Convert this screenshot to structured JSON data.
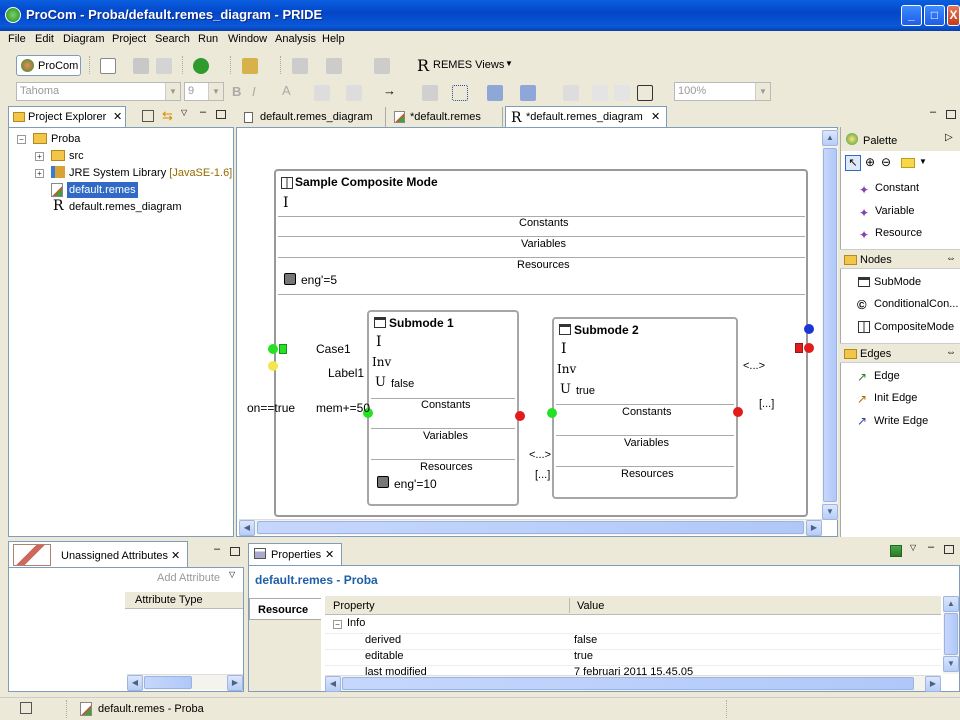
{
  "window": {
    "title": "ProCom - Proba/default.remes_diagram - PRIDE",
    "min": "_",
    "max": "□",
    "close": "X"
  },
  "menu": [
    "File",
    "Edit",
    "Diagram",
    "Project",
    "Search",
    "Run",
    "Window",
    "Analysis",
    "Help"
  ],
  "toolbar": {
    "procom_label": "ProCom",
    "remes_views_label": "REMES Views",
    "font_combo": "Tahoma",
    "size_combo": "9",
    "zoom_combo": "100%"
  },
  "project_explorer": {
    "tab_label": "Project Explorer",
    "tree": [
      {
        "label": "Proba"
      },
      {
        "label": "src"
      },
      {
        "label": "JRE System Library",
        "suffix": "[JavaSE-1.6]"
      },
      {
        "label": "default.remes"
      },
      {
        "label": "default.remes_diagram"
      }
    ]
  },
  "editor_tabs": [
    {
      "label": "default.remes_diagram"
    },
    {
      "label": "*default.remes"
    },
    {
      "label": "*default.remes_diagram"
    }
  ],
  "diagram": {
    "composite": {
      "title": "Sample Composite Mode",
      "invariant": "I",
      "constants": "Constants",
      "variables": "Variables",
      "resources": "Resources",
      "resource_value": "eng'=5"
    },
    "submode1": {
      "title": "Submode 1",
      "i": "I",
      "inv": "Inv",
      "u": "U",
      "u_value": "false",
      "constants": "Constants",
      "variables": "Variables",
      "resources": "Resources",
      "resource_value": "eng'=10"
    },
    "submode2": {
      "title": "Submode 2",
      "i": "I",
      "inv": "Inv",
      "u": "U",
      "u_value": "true",
      "constants": "Constants",
      "variables": "Variables",
      "resources": "Resources"
    },
    "labels": {
      "case1": "Case1",
      "label1": "Label1",
      "guard": "on==true",
      "action": "mem+=50",
      "mid_top": "<...>",
      "mid_bottom": "[...]",
      "right_top": "<...>",
      "right_bottom": "[...]"
    }
  },
  "palette": {
    "title": "Palette",
    "items_top": [
      "Constant",
      "Variable",
      "Resource"
    ],
    "nodes_label": "Nodes",
    "nodes": [
      "SubMode",
      "ConditionalCon...",
      "CompositeMode"
    ],
    "edges_label": "Edges",
    "edges": [
      "Edge",
      "Init Edge",
      "Write Edge"
    ]
  },
  "unassigned": {
    "tab_label": "Unassigned Attributes",
    "add_label": "Add Attribute",
    "column": "Attribute Type"
  },
  "properties": {
    "tab_label": "Properties",
    "header": "default.remes - Proba",
    "side_tab": "Resource",
    "col_property": "Property",
    "col_value": "Value",
    "group": "Info",
    "rows": [
      {
        "name": "derived",
        "value": "false"
      },
      {
        "name": "editable",
        "value": "true"
      },
      {
        "name": "last modified",
        "value": "7 februari 2011 15.45.05"
      }
    ]
  },
  "statusbar": {
    "text": "default.remes - Proba"
  },
  "colors": {
    "titlebar": "#0a5fe0",
    "selection": "#316ac5",
    "header_blue": "#1f5fa8"
  }
}
